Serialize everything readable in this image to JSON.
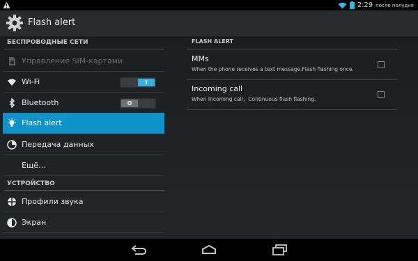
{
  "status_bar": {
    "time": "2:29",
    "ampm": "после полудня",
    "icons": [
      "warning-icon",
      "wifi-icon",
      "battery-icon"
    ]
  },
  "action_bar": {
    "title": "Flash alert",
    "icon": "settings-gear-icon"
  },
  "left_pane": {
    "wireless_header": "БЕСПРОВОДНЫЕ СЕТИ",
    "device_header": "УСТРОЙСТВО",
    "items": [
      {
        "label": "Управление SIM-картами",
        "icon": "sim-icon",
        "disabled": true
      },
      {
        "label": "Wi-Fi",
        "icon": "wifi-icon",
        "toggle": "on",
        "toggle_text": "I"
      },
      {
        "label": "Bluetooth",
        "icon": "bluetooth-icon",
        "toggle": "off",
        "toggle_text": "O"
      },
      {
        "label": "Flash alert",
        "icon": "bulb-icon",
        "selected": true
      },
      {
        "label": "Передача данных",
        "icon": "data-usage-icon"
      },
      {
        "label": "Ещё…"
      },
      {
        "label": "Профили звука",
        "icon": "sound-profile-icon"
      },
      {
        "label": "Экран",
        "icon": "display-icon"
      }
    ]
  },
  "right_pane": {
    "header": "FLASH ALERT",
    "prefs": [
      {
        "title": "MMs",
        "summary": "When the phone receives a text message.Flash flashing once.",
        "checked": false
      },
      {
        "title": "Incoming call",
        "summary": "When Incoming call，Continuous flash flashing.",
        "checked": false
      }
    ]
  },
  "nav_bar": {
    "buttons": [
      "back-icon",
      "home-icon",
      "recent-apps-icon"
    ]
  },
  "colors": {
    "accent": "#0e93c8",
    "toggle_on": "#35b2e4"
  }
}
